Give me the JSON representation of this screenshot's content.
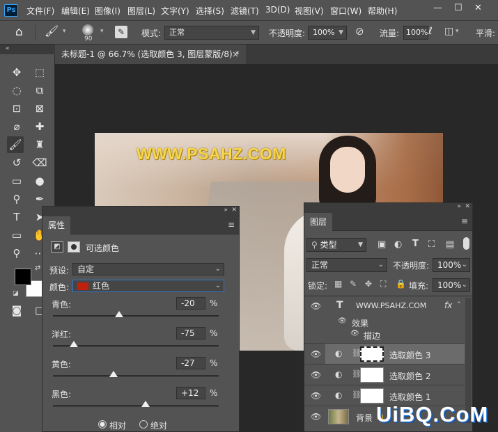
{
  "app": {
    "logo": "Ps"
  },
  "menu": [
    "文件(F)",
    "编辑(E)",
    "图像(I)",
    "图层(L)",
    "文字(Y)",
    "选择(S)",
    "滤镜(T)",
    "3D(D)",
    "视图(V)",
    "窗口(W)",
    "帮助(H)"
  ],
  "window_controls": {
    "minimize": "—",
    "maximize": "☐",
    "close": "✕"
  },
  "options": {
    "brush_size": "90",
    "mode_label": "模式:",
    "mode_value": "正常",
    "opacity_label": "不透明度:",
    "opacity_value": "100%",
    "flow_label": "流量:",
    "flow_value": "100%",
    "smooth_label": "平滑:"
  },
  "document": {
    "tab_title": "未标题-1 @ 66.7% (选取颜色 3, 图层蒙版/8) *",
    "close": "×",
    "collapse": "«"
  },
  "canvas": {
    "watermark": "WWW.PSAHZ.COM"
  },
  "properties": {
    "tab": "属性",
    "adjustment_title": "可选颜色",
    "preset_label": "预设:",
    "preset_value": "自定",
    "color_label": "颜色:",
    "color_value": "红色",
    "color_swatch": "#c0200e",
    "sliders": [
      {
        "label": "青色:",
        "value": "-20",
        "unit": "%",
        "fraction": 0.4
      },
      {
        "label": "洋红:",
        "value": "-75",
        "unit": "%",
        "fraction": 0.125
      },
      {
        "label": "黄色:",
        "value": "-27",
        "unit": "%",
        "fraction": 0.365
      },
      {
        "label": "黑色:",
        "value": "+12",
        "unit": "%",
        "fraction": 0.56
      }
    ],
    "method": {
      "relative": "相对",
      "absolute": "绝对"
    }
  },
  "layers": {
    "tab": "图层",
    "filter_label": "类型",
    "blend_value": "正常",
    "opacity_label": "不透明度:",
    "opacity_value": "100%",
    "lock_label": "锁定:",
    "fill_label": "填充:",
    "fill_value": "100%",
    "text_layer": "WWW.PSAHZ.COM",
    "fx": "fx",
    "effects_label": "效果",
    "stroke_label": "描边",
    "adjust_layers": [
      "选取颜色 3",
      "选取颜色 2",
      "选取颜色 1"
    ],
    "background_layer": "背景",
    "text_type_icon": "T"
  },
  "site_logo": "UiBQ.CoM",
  "colors": {
    "accent": "#2fa3f6",
    "panel": "#535353",
    "selected_row": "#6b6b6b",
    "watermark": "#f7d64a"
  }
}
